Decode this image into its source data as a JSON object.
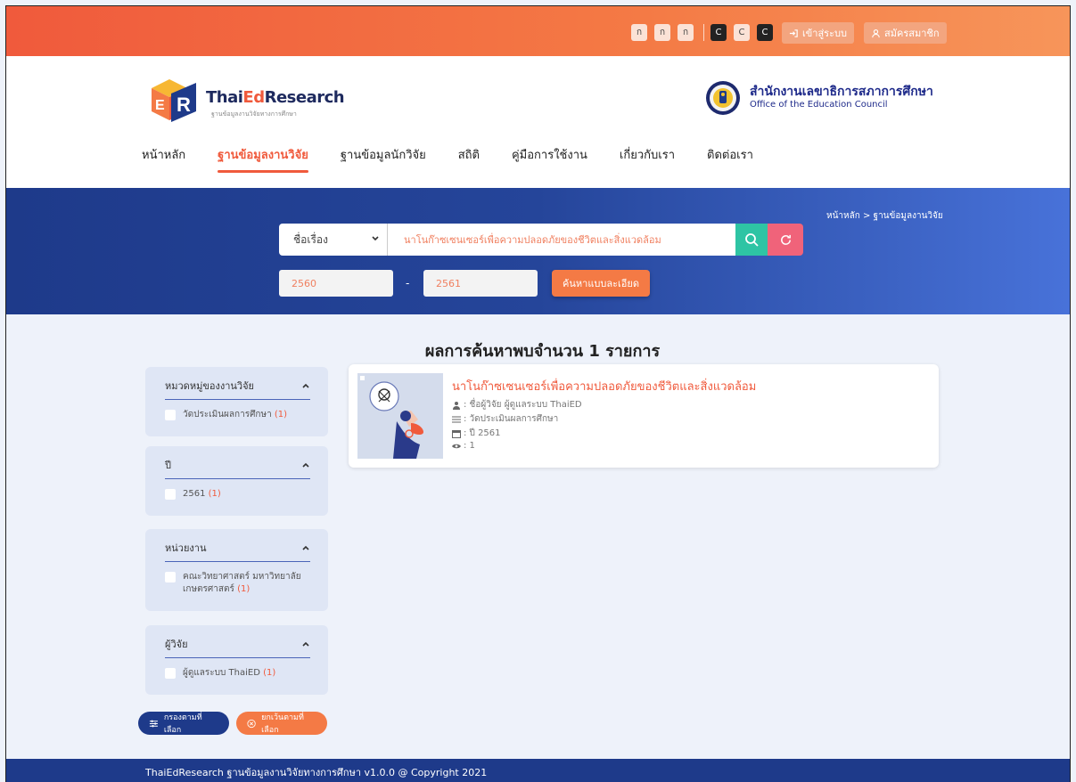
{
  "topbar": {
    "font_sizes": [
      "ก",
      "ก",
      "ก"
    ],
    "contrast": [
      "C",
      "C",
      "C"
    ],
    "login_label": "เข้าสู่ระบบ",
    "register_label": "สมัครสมาชิก"
  },
  "header": {
    "logo_name_a": "Thai",
    "logo_name_b": "Ed",
    "logo_name_c": "Research",
    "logo_sub": "ฐานข้อมูลงานวิจัยทางการศึกษา",
    "org_th": "สำนักงานเลขาธิการสภาการศึกษา",
    "org_en": "Office of the Education Council"
  },
  "nav": [
    {
      "label": "หน้าหลัก"
    },
    {
      "label": "ฐานข้อมูลงานวิจัย"
    },
    {
      "label": "ฐานข้อมูลนักวิจัย"
    },
    {
      "label": "สถิติ"
    },
    {
      "label": "คู่มือการใช้งาน"
    },
    {
      "label": "เกี่ยวกับเรา"
    },
    {
      "label": "ติดต่อเรา"
    }
  ],
  "search": {
    "breadcrumb": "หน้าหลัก > ฐานข้อมูลงานวิจัย",
    "field_selected": "ชื่อเรื่อง",
    "query": "นาโนก๊าซเซนเซอร์เพื่อความปลอดภัยของชีวิตและสิ่งแวดล้อม",
    "year_from": "2560",
    "year_to": "2561",
    "dash": "-",
    "advanced_label": "ค้นหาแบบละเอียด"
  },
  "results": {
    "title": "ผลการค้นหาพบจำนวน 1 รายการ"
  },
  "filters": [
    {
      "title": "หมวดหมู่ของงานวิจัย",
      "option": "วัดประเมินผลการศึกษา",
      "count": "(1)"
    },
    {
      "title": "ปี",
      "option": "2561",
      "count": "(1)"
    },
    {
      "title": "หน่วยงาน",
      "option": "คณะวิทยาศาสตร์ มหาวิทยาลัยเกษตรศาสตร์",
      "count": "(1)"
    },
    {
      "title": "ผู้วิจัย",
      "option": "ผู้ดูแลระบบ ThaiED",
      "count": "(1)"
    }
  ],
  "filter_actions": {
    "apply_label": "กรองตามที่เลือก",
    "clear_label": "ยกเว้นตามที่เลือก"
  },
  "card": {
    "title": "นาโนก๊าซเซนเซอร์เพื่อความปลอดภัยของชีวิตและสิ่งแวดล้อม",
    "researcher": ": ชื่อผู้วิจัย ผู้ดูแลระบบ ThaiED",
    "category": ": วัดประเมินผลการศึกษา",
    "year": ": ปี 2561",
    "views": ": 1"
  },
  "footer": {
    "text": "ThaiEdResearch ฐานข้อมูลงานวิจัยทางการศึกษา v1.0.0 @ Copyright 2021"
  },
  "colors": {
    "brand_orange": "#f05a3c",
    "brand_navy": "#1e3a8a",
    "search_green": "#2ec4a4",
    "reset_pink": "#f0637a"
  },
  "icons": [
    "login-icon",
    "user-icon",
    "search-icon",
    "refresh-icon",
    "chevron-down-icon",
    "chevron-up-icon",
    "sliders-icon",
    "close-circle-icon",
    "user-small-icon",
    "list-icon",
    "calendar-icon",
    "eye-icon"
  ]
}
